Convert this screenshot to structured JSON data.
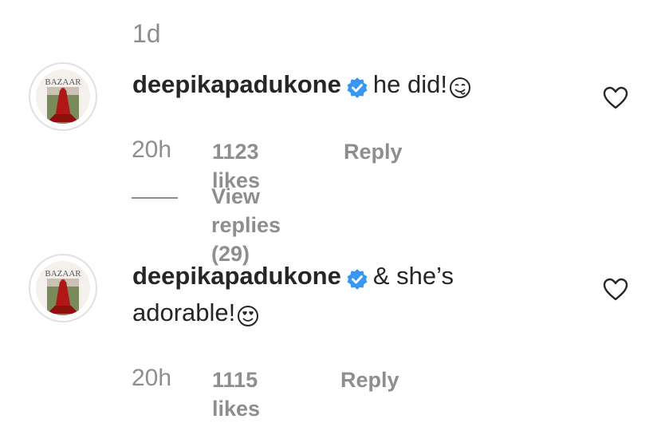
{
  "top_timestamp": "1d",
  "comments": [
    {
      "username": "deepikapadukone",
      "text": "he did!",
      "emoji": "smiling-face-with-tongue-icon",
      "time": "20h",
      "likes": "1123 likes",
      "reply_label": "Reply",
      "view_replies": "View replies (29)",
      "avatar_text": "BAZAAR"
    },
    {
      "username": "deepikapadukone",
      "text_line1": "& she’s",
      "text_line2": "adorable!",
      "emoji": "smiling-face-with-heart-eyes-icon",
      "time": "20h",
      "likes": "1115 likes",
      "reply_label": "Reply",
      "avatar_text": "BAZAAR"
    }
  ],
  "colors": {
    "text": "#262626",
    "muted": "#8e8e8e",
    "verified": "#3897f0"
  }
}
